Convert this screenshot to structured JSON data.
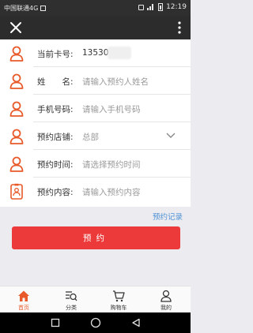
{
  "status_bar": {
    "carrier": "中国联通4G",
    "time": "12:19"
  },
  "form": {
    "card": {
      "label": "当前卡号:",
      "value": "135309"
    },
    "name": {
      "label": "姓　　名:",
      "placeholder": "请输入预约人姓名"
    },
    "phone": {
      "label": "手机号码:",
      "placeholder": "请输入手机号码"
    },
    "store": {
      "label": "预约店铺:",
      "value": "总部"
    },
    "time": {
      "label": "预约时间:",
      "placeholder": "请选择预约时间"
    },
    "content": {
      "label": "预约内容:",
      "placeholder": "请输入预约内容"
    }
  },
  "records_link": "预约记录",
  "submit_label": "预约",
  "tabs": [
    {
      "label": "首页",
      "icon": "home-icon",
      "active": true
    },
    {
      "label": "分类",
      "icon": "category-search-icon",
      "active": false
    },
    {
      "label": "购物车",
      "icon": "cart-icon",
      "active": false
    },
    {
      "label": "我的",
      "icon": "profile-icon",
      "active": false
    }
  ],
  "colors": {
    "accent": "#e85a2a",
    "submit": "#ec3a3a",
    "link": "#4d90d6"
  }
}
